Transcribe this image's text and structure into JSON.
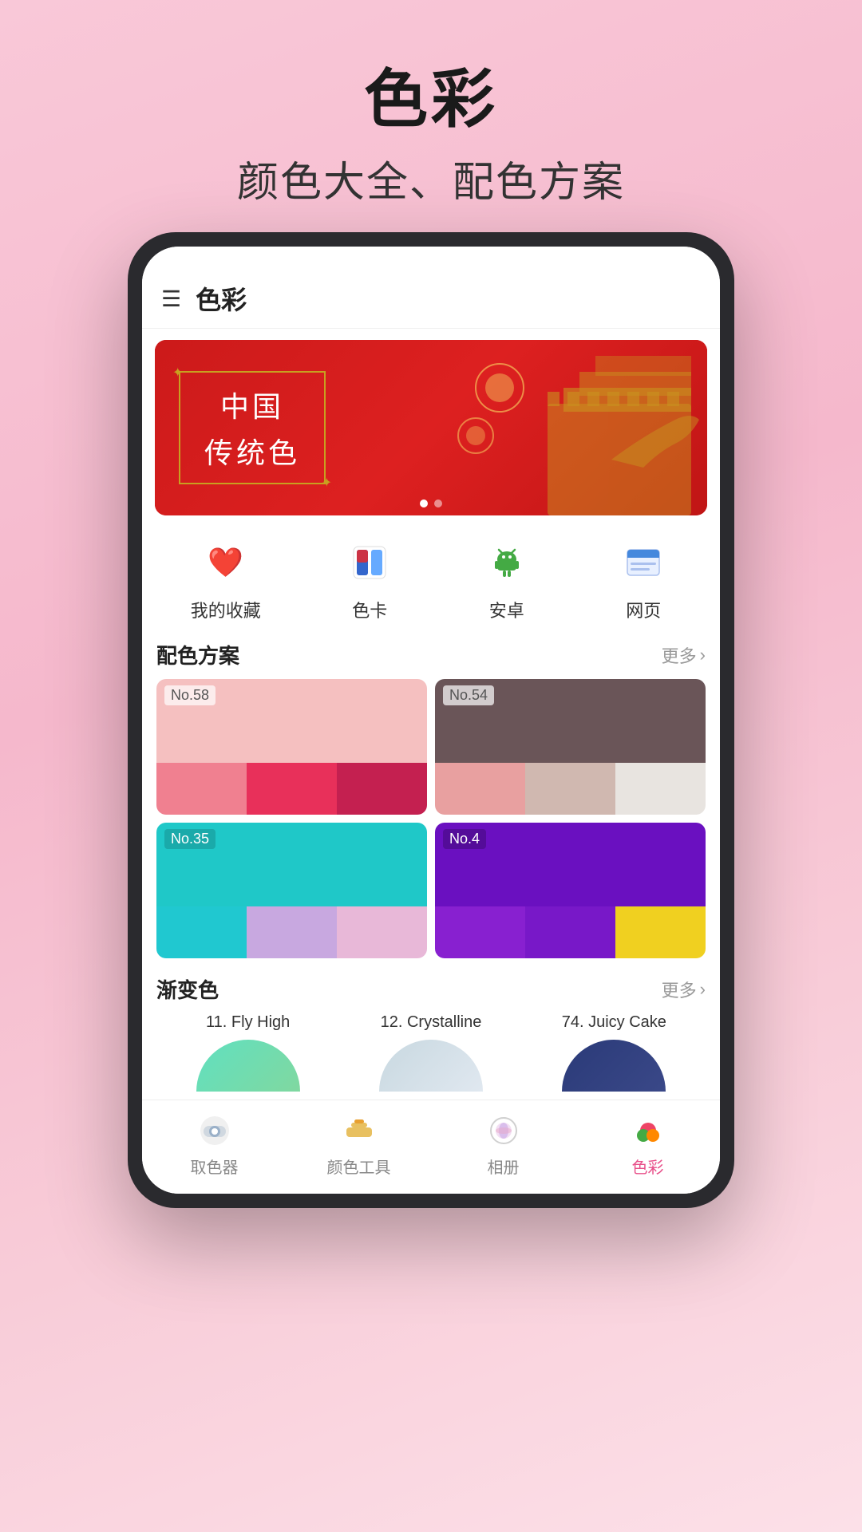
{
  "app": {
    "title": "色彩",
    "subtitle": "颜色大全、配色方案"
  },
  "header": {
    "menu_icon": "☰",
    "title": "色彩"
  },
  "banner": {
    "line1": "中国",
    "line2": "传统色",
    "dots": [
      true,
      false
    ]
  },
  "quick_nav": {
    "items": [
      {
        "label": "我的收藏",
        "icon": "❤️",
        "color": "#e8508a"
      },
      {
        "label": "色卡",
        "icon": "🎨",
        "color": "#4488dd"
      },
      {
        "label": "安卓",
        "icon": "🤖",
        "color": "#44aa44"
      },
      {
        "label": "网页",
        "icon": "📋",
        "color": "#4488dd"
      }
    ]
  },
  "palette_section": {
    "title": "配色方案",
    "more": "更多",
    "cards": [
      {
        "no": "No.58",
        "top_color": "#f5c0c0",
        "swatches": [
          "#f08090",
          "#e8305a",
          "#c42050"
        ]
      },
      {
        "no": "No.54",
        "top_color": "#6a5558",
        "swatches": [
          "#e8a0a0",
          "#d0b8b0",
          "#e8e4e0"
        ]
      },
      {
        "no": "No.35",
        "top_color": "#1fc8c8",
        "swatches": [
          "#20c8d0",
          "#c8a8e0",
          "#e8b8d8"
        ]
      },
      {
        "no": "No.4",
        "top_color": "#6a10c0",
        "swatches": [
          "#8820d0",
          "#7818c8",
          "#f0d020"
        ]
      }
    ]
  },
  "gradient_section": {
    "title": "渐变色",
    "more": "更多",
    "items": [
      {
        "title": "11. Fly High",
        "gradient_start": "#60e0c0",
        "gradient_end": "#80d8b0"
      },
      {
        "title": "12. Crystalline",
        "gradient_start": "#c8d8e0",
        "gradient_end": "#e0e8f0"
      },
      {
        "title": "74. Juicy Cake",
        "gradient_start": "#2a3a78",
        "gradient_end": "#3a4888"
      }
    ]
  },
  "bottom_nav": {
    "items": [
      {
        "label": "取色器",
        "icon": "🎨",
        "active": false
      },
      {
        "label": "颜色工具",
        "icon": "🧰",
        "active": false
      },
      {
        "label": "相册",
        "icon": "🪄",
        "active": false
      },
      {
        "label": "色彩",
        "icon": "🍎",
        "active": true
      }
    ]
  }
}
